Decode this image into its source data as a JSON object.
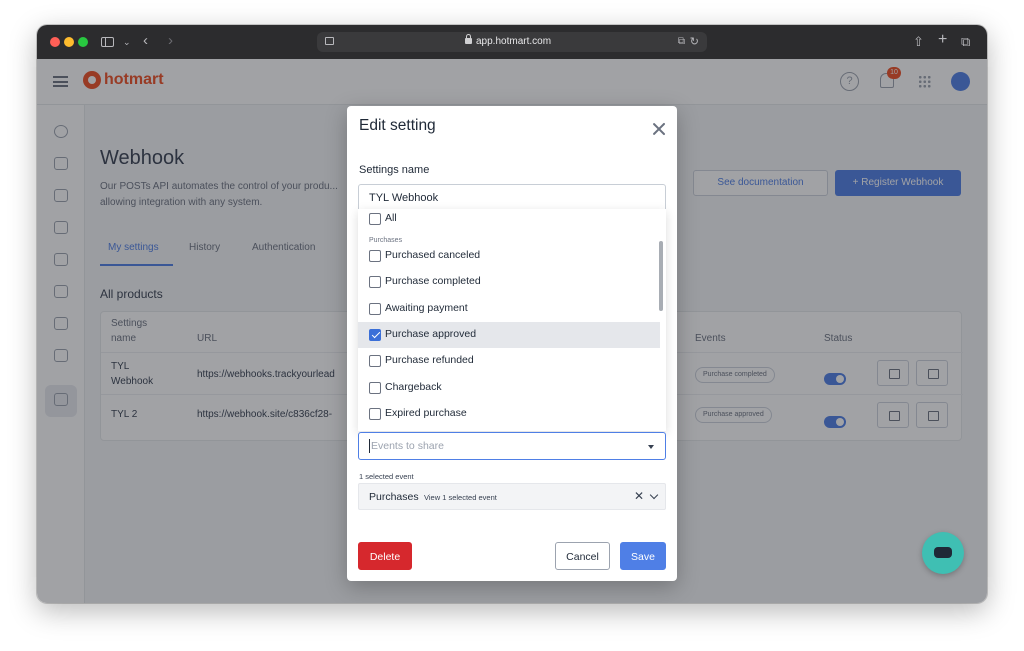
{
  "browser": {
    "url": "app.hotmart.com"
  },
  "app": {
    "logo_text": "hotmart",
    "notification_count": "10"
  },
  "background": {
    "page_title": "Webhook",
    "description": "Our POSTs API automates the control of your produ... allowing integration with any system.",
    "see_documentation": "See documentation",
    "register_webhook": "+ Register Webhook",
    "tabs": [
      "My settings",
      "History",
      "Authentication"
    ],
    "products_label": "All products",
    "table": {
      "headers": {
        "settings_name": "Settings name",
        "url": "URL",
        "events": "Events",
        "status": "Status"
      },
      "rows": [
        {
          "name": "TYL Webhook",
          "url": "https://webhooks.trackyourlead",
          "event": "Purchase completed"
        },
        {
          "name": "TYL 2",
          "url": "https://webhook.site/c836cf28-",
          "event": "Purchase approved"
        }
      ]
    }
  },
  "modal": {
    "title": "Edit setting",
    "settings_name_label": "Settings name",
    "settings_name_value": "TYL Webhook",
    "dropdown": {
      "all_label": "All",
      "group_label": "Purchases",
      "options": [
        {
          "label": "Purchased canceled",
          "checked": false
        },
        {
          "label": "Purchase completed",
          "checked": false
        },
        {
          "label": "Awaiting payment",
          "checked": false
        },
        {
          "label": "Purchase approved",
          "checked": true
        },
        {
          "label": "Purchase refunded",
          "checked": false
        },
        {
          "label": "Chargeback",
          "checked": false
        },
        {
          "label": "Expired purchase",
          "checked": false
        }
      ]
    },
    "events_placeholder": "Events to share",
    "selected_count": "1 selected event",
    "chip": {
      "name": "Purchases",
      "view": "View 1 selected event",
      "remove": "✕"
    },
    "buttons": {
      "delete": "Delete",
      "cancel": "Cancel",
      "save": "Save"
    }
  },
  "colors": {
    "accent": "#4f7fe6",
    "danger": "#d6282d",
    "brand": "#ef4e23",
    "chat": "#3fbfb3"
  }
}
